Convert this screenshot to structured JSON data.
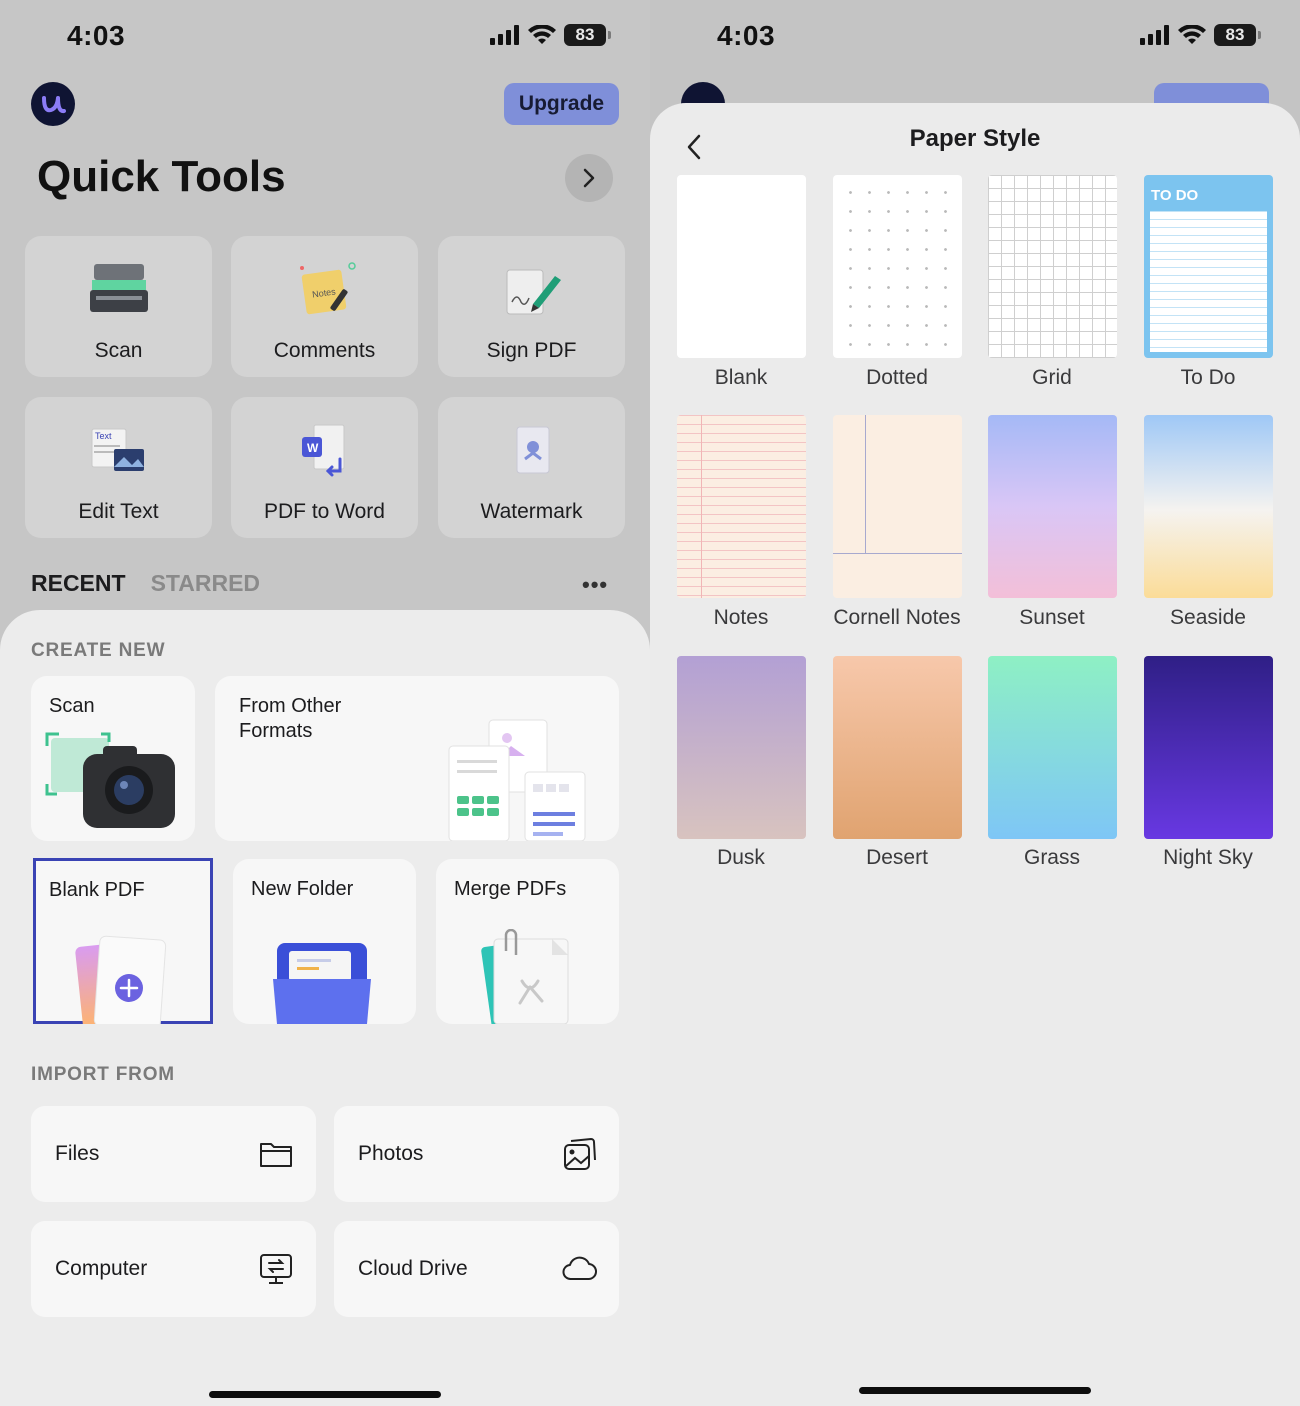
{
  "left": {
    "status": {
      "time": "4:03",
      "battery": "83"
    },
    "upgrade_label": "Upgrade",
    "quick_tools": {
      "title": "Quick Tools",
      "tools": [
        {
          "label": "Scan",
          "icon": "scanner-icon"
        },
        {
          "label": "Comments",
          "icon": "notes-comment-icon"
        },
        {
          "label": "Sign PDF",
          "icon": "signature-pen-icon"
        },
        {
          "label": "Edit Text",
          "icon": "edit-text-icon"
        },
        {
          "label": "PDF to Word",
          "icon": "word-convert-icon"
        },
        {
          "label": "Watermark",
          "icon": "watermark-icon"
        }
      ],
      "comments_icon_text": "Notes",
      "edit_text_icon_text": "Text",
      "word_icon_text": "W"
    },
    "tabs": {
      "recent": "RECENT",
      "starred": "STARRED"
    },
    "create_new": {
      "label": "CREATE NEW",
      "scan": "Scan",
      "from_other_formats": "From Other Formats",
      "blank_pdf": "Blank PDF",
      "new_folder": "New Folder",
      "merge_pdfs": "Merge PDFs"
    },
    "import_from": {
      "label": "IMPORT FROM",
      "items": [
        {
          "label": "Files",
          "icon": "folder-icon"
        },
        {
          "label": "Photos",
          "icon": "photos-icon"
        },
        {
          "label": "Computer",
          "icon": "computer-transfer-icon"
        },
        {
          "label": "Cloud Drive",
          "icon": "cloud-icon"
        }
      ]
    }
  },
  "right": {
    "status": {
      "time": "4:03",
      "battery": "83"
    },
    "title": "Paper Style",
    "todo_header": "TO DO",
    "styles": [
      {
        "label": "Blank"
      },
      {
        "label": "Dotted"
      },
      {
        "label": "Grid"
      },
      {
        "label": "To Do"
      },
      {
        "label": "Notes"
      },
      {
        "label": "Cornell Notes"
      },
      {
        "label": "Sunset"
      },
      {
        "label": "Seaside"
      },
      {
        "label": "Dusk"
      },
      {
        "label": "Desert"
      },
      {
        "label": "Grass"
      },
      {
        "label": "Night Sky"
      }
    ]
  },
  "colors": {
    "accent": "#3a43b4",
    "upgrade": "#7f8fd9",
    "todo_blue": "#7cc4ef"
  }
}
